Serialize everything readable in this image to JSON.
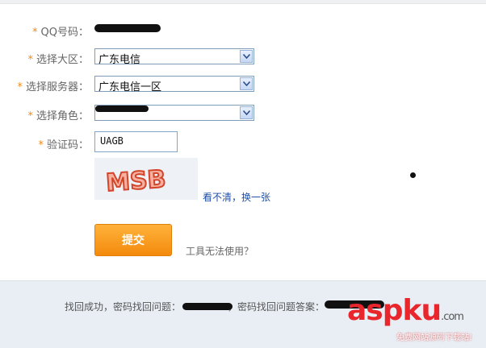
{
  "form": {
    "qq": {
      "required": "*",
      "label": "QQ号码："
    },
    "region": {
      "required": "*",
      "label": "选择大区：",
      "value": "广东电信"
    },
    "server": {
      "required": "*",
      "label": "选择服务器：",
      "value": "广东电信一区"
    },
    "role": {
      "required": "*",
      "label": "选择角色："
    },
    "captcha": {
      "required": "*",
      "label": "验证码：",
      "value": "UAGB",
      "image_text": "MSB"
    },
    "refresh_link": "看不清，换一张",
    "submit_label": "提交",
    "tool_link": "工具无法使用？"
  },
  "footer": {
    "success_text": "找回成功，密码找回问题：",
    "answer_text": "，密码找回问题答案："
  },
  "watermark": {
    "brand_a": "asp",
    "brand_b": "ku",
    "domain": ".com",
    "subtitle": "免费网站源码下载站!"
  },
  "colors": {
    "required_star": "#f08a1c",
    "submit_button": "#f38a0d",
    "link": "#1f4fa6",
    "footer_bg": "#e9eef4"
  }
}
